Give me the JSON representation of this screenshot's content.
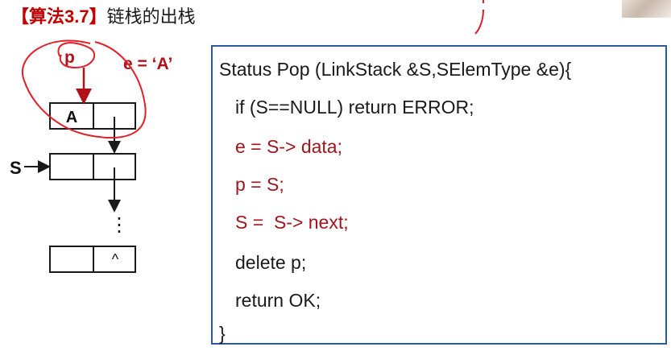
{
  "title": {
    "bracket": "【算法3.7】",
    "text": "链栈的出栈"
  },
  "diagram": {
    "pointer_p_label": "p",
    "e_assign_label": "e = ‘A’",
    "stack_label": "S",
    "node_top_data": "A",
    "node_tail_next": "^",
    "ellipsis": "⋮"
  },
  "code": {
    "lines": [
      "Status Pop (LinkStack &S,SElemType &e){",
      "if (S==NULL) return ERROR;",
      "e = S-> data;",
      "p = S;",
      "S =  S-> next;",
      "delete p;",
      "return OK;",
      "}"
    ]
  },
  "colors": {
    "accent_red": "#c00000",
    "code_red": "#a0161b",
    "box_border": "#2e5a9a",
    "annotation_red": "#e0202a"
  }
}
